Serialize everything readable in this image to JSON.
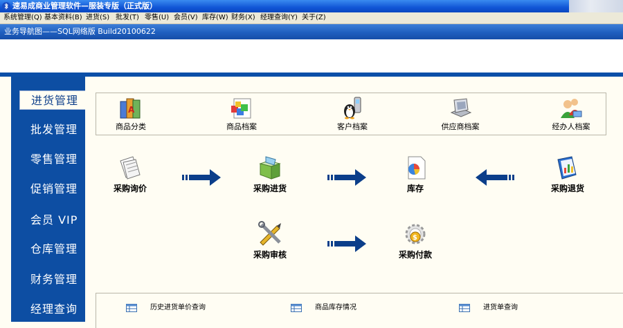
{
  "window": {
    "title": "速易成商业管理软件—服装专版（正式版）",
    "icon": "bluetooth-icon"
  },
  "menu": [
    "系统管理(Q)",
    "基本资料(B)",
    "进货(S)",
    "批发(T)",
    "零售(U)",
    "会员(V)",
    "库存(W)",
    "财务(X)",
    "经理查询(Y)",
    "关于(Z)"
  ],
  "nav_title": "业务导航图——SQL网络版 Build20100622",
  "sidebar": {
    "active": "进货管理",
    "items": [
      "进货管理",
      "批发管理",
      "零售管理",
      "促销管理",
      "会员 VIP",
      "仓库管理",
      "财务管理",
      "经理查询"
    ]
  },
  "top_icons": [
    {
      "label": "商品分类",
      "icon": "category-books-icon"
    },
    {
      "label": "商品档案",
      "icon": "product-blocks-icon"
    },
    {
      "label": "客户档案",
      "icon": "customer-penguin-phone-icon"
    },
    {
      "label": "供应商档案",
      "icon": "supplier-monitor-icon"
    },
    {
      "label": "经办人档案",
      "icon": "handler-users-icon"
    }
  ],
  "flow": {
    "inquiry": {
      "label": "采购询价",
      "icon": "papers-icon"
    },
    "purchase": {
      "label": "采购进货",
      "icon": "folder-icon"
    },
    "stock": {
      "label": "库存",
      "icon": "document-chart-icon"
    },
    "return": {
      "label": "采购退货",
      "icon": "report-book-icon"
    },
    "audit": {
      "label": "采购审核",
      "icon": "tools-icon"
    },
    "payment": {
      "label": "采购付款",
      "icon": "gear-coin-icon"
    }
  },
  "bottom_links": [
    "历史进货单价查询",
    "商品库存情况",
    "进货单查询"
  ],
  "colors": {
    "titlebar": "#1156d6",
    "sidebar": "#0d4ea3",
    "arrow": "#0b3e8a",
    "background": "#fffdf3"
  }
}
